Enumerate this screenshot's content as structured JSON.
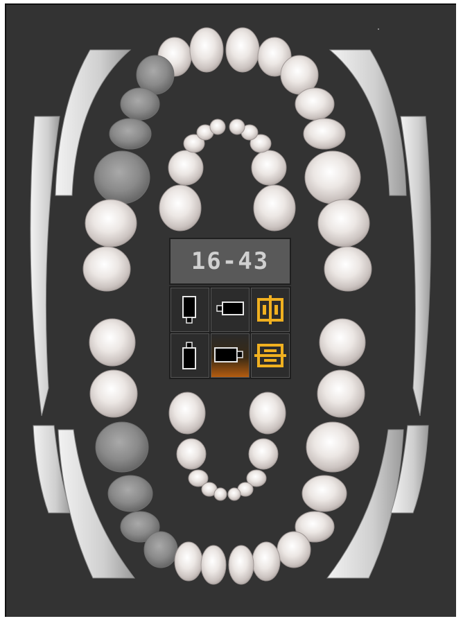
{
  "range_display": "16-43",
  "tools": [
    {
      "name": "tool-vertical-single-icon",
      "active": false
    },
    {
      "name": "tool-horizontal-single-icon",
      "active": false
    },
    {
      "name": "tool-vertical-split-icon",
      "active": false
    },
    {
      "name": "tool-vertical-single-alt-icon",
      "active": false
    },
    {
      "name": "tool-horizontal-single-alt-icon",
      "active": true
    },
    {
      "name": "tool-horizontal-split-icon",
      "active": false
    }
  ],
  "colors": {
    "background": "#333333",
    "tooth_normal": "#e6e1de",
    "tooth_selected": "#8a8a8a",
    "accent": "#f0b020",
    "active_tool": "#b45c10"
  }
}
